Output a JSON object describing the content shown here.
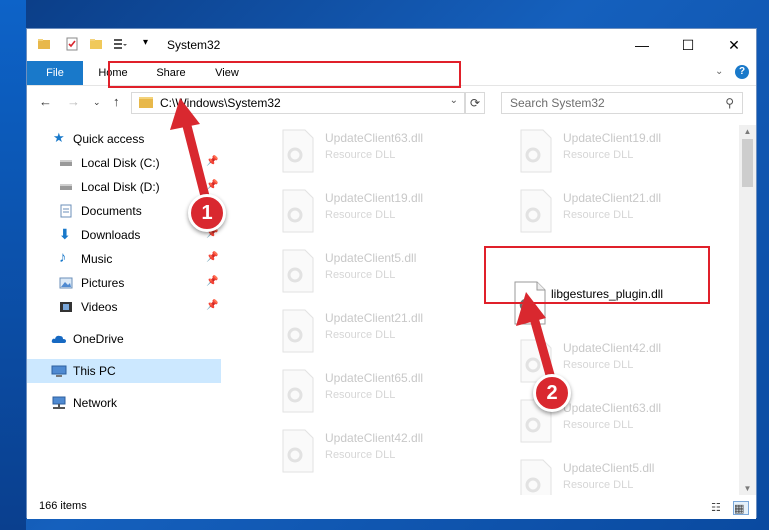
{
  "window": {
    "title": "System32",
    "controls": {
      "minimize": "—",
      "maximize": "☐",
      "close": "✕"
    }
  },
  "ribbon": {
    "tabs": [
      "File",
      "Home",
      "Share",
      "View"
    ]
  },
  "navigation": {
    "address": "C:\\Windows\\System32",
    "search_placeholder": "Search System32"
  },
  "nav_pane": {
    "items": [
      {
        "label": "Quick access",
        "icon": "star-icon",
        "pinned": false
      },
      {
        "label": "Local Disk (C:)",
        "icon": "drive-icon",
        "pinned": true
      },
      {
        "label": "Local Disk (D:)",
        "icon": "drive-icon",
        "pinned": true
      },
      {
        "label": "Documents",
        "icon": "documents-icon",
        "pinned": true
      },
      {
        "label": "Downloads",
        "icon": "download-icon",
        "pinned": true
      },
      {
        "label": "Music",
        "icon": "music-icon",
        "pinned": true
      },
      {
        "label": "Pictures",
        "icon": "pictures-icon",
        "pinned": true
      },
      {
        "label": "Videos",
        "icon": "videos-icon",
        "pinned": true
      },
      {
        "label": "OneDrive",
        "icon": "cloud-icon",
        "pinned": false
      },
      {
        "label": "This PC",
        "icon": "computer-icon",
        "pinned": false,
        "selected": true
      },
      {
        "label": "Network",
        "icon": "network-icon",
        "pinned": false
      }
    ]
  },
  "files": {
    "left_column": [
      {
        "name": "UpdateClient63.dll",
        "type": "Resource DLL"
      },
      {
        "name": "UpdateClient19.dll",
        "type": "Resource DLL"
      },
      {
        "name": "UpdateClient5.dll",
        "type": "Resource DLL"
      },
      {
        "name": "UpdateClient21.dll",
        "type": "Resource DLL"
      },
      {
        "name": "UpdateClient65.dll",
        "type": "Resource DLL"
      },
      {
        "name": "UpdateClient42.dll",
        "type": "Resource DLL"
      }
    ],
    "right_column": [
      {
        "name": "UpdateClient19.dll",
        "type": "Resource DLL"
      },
      {
        "name": "UpdateClient21.dll",
        "type": "Resource DLL"
      },
      {
        "name": "libgestures_plugin.dll",
        "type": "",
        "highlighted": true
      },
      {
        "name": "UpdateClient42.dll",
        "type": "Resource DLL"
      },
      {
        "name": "UpdateClient63.dll",
        "type": "Resource DLL"
      },
      {
        "name": "UpdateClient5.dll",
        "type": "Resource DLL"
      }
    ]
  },
  "status_bar": {
    "item_count": "166 items"
  },
  "annotations": {
    "step1": "1",
    "step2": "2"
  },
  "colors": {
    "accent": "#1979ca",
    "annotation_red": "#e0202a",
    "selected": "#cce8ff"
  }
}
